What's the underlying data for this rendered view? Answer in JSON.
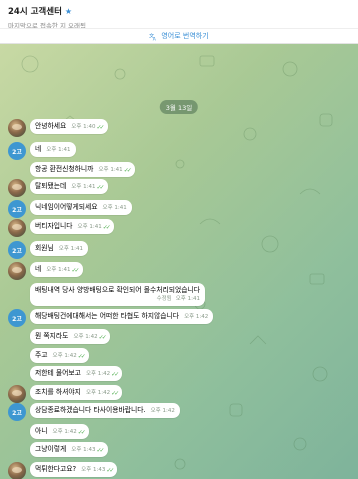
{
  "header": {
    "title": "24시 고객센터",
    "subtitle": "마지막으로 접속한 지 오래됨"
  },
  "translate": {
    "label": "영어로 번역하기"
  },
  "chat": {
    "date": "3월 13일",
    "messages": [
      {
        "avatar": "photo",
        "avatar_label": "",
        "text": "안녕하세요",
        "time": "오후 1:40",
        "read": true,
        "edited": ""
      },
      {
        "avatar": "text",
        "avatar_label": "2고",
        "text": "네",
        "time": "오후 1:41",
        "read": false,
        "edited": ""
      },
      {
        "avatar": "none",
        "avatar_label": "",
        "text": "항공 환전신청하니까",
        "time": "오후 1:41",
        "read": true,
        "edited": ""
      },
      {
        "avatar": "photo",
        "avatar_label": "",
        "text": "탈퇴됐는데",
        "time": "오후 1:41",
        "read": true,
        "edited": ""
      },
      {
        "avatar": "text",
        "avatar_label": "2고",
        "text": "닉네임이어떻게되세요",
        "time": "오후 1:41",
        "read": false,
        "edited": ""
      },
      {
        "avatar": "photo",
        "avatar_label": "",
        "text": "버티자입니다",
        "time": "오후 1:41",
        "read": true,
        "edited": ""
      },
      {
        "avatar": "text",
        "avatar_label": "2고",
        "text": "회원님",
        "time": "오후 1:41",
        "read": false,
        "edited": ""
      },
      {
        "avatar": "photo",
        "avatar_label": "",
        "text": "네",
        "time": "오후 1:41",
        "read": true,
        "edited": ""
      },
      {
        "avatar": "none",
        "avatar_label": "",
        "text": "배팅내역 당사 양방배팅으로 확인되어 몰수처리되었습니다",
        "time": "오후 1:41",
        "read": false,
        "edited": "수정됨"
      },
      {
        "avatar": "text",
        "avatar_label": "2고",
        "text": "해당배팅건에대해서는 어떠한 타협도 하지않습니다",
        "time": "오후 1:42",
        "read": false,
        "edited": ""
      },
      {
        "avatar": "none",
        "avatar_label": "",
        "text": "뭔 쪽지라도",
        "time": "오후 1:42",
        "read": true,
        "edited": ""
      },
      {
        "avatar": "none",
        "avatar_label": "",
        "text": "주고",
        "time": "오후 1:42",
        "read": true,
        "edited": ""
      },
      {
        "avatar": "none",
        "avatar_label": "",
        "text": "저한테 물어보고",
        "time": "오후 1:42",
        "read": true,
        "edited": ""
      },
      {
        "avatar": "photo",
        "avatar_label": "",
        "text": "조치를 하셔야지",
        "time": "오후 1:42",
        "read": true,
        "edited": ""
      },
      {
        "avatar": "text",
        "avatar_label": "2고",
        "text": "상담종료하겠습니다 타사이용바랍니다.",
        "time": "오후 1:42",
        "read": false,
        "edited": ""
      },
      {
        "avatar": "none",
        "avatar_label": "",
        "text": "아니",
        "time": "오후 1:42",
        "read": true,
        "edited": ""
      },
      {
        "avatar": "none",
        "avatar_label": "",
        "text": "그냥이렇게",
        "time": "오후 1:43",
        "read": true,
        "edited": ""
      },
      {
        "avatar": "photo",
        "avatar_label": "",
        "text": "먹튀한다고요?",
        "time": "오후 1:43",
        "read": true,
        "edited": ""
      }
    ]
  },
  "colors": {
    "accent": "#3a8fd6",
    "check": "#4fae4e",
    "avatar_blue": "#3e97d1"
  }
}
